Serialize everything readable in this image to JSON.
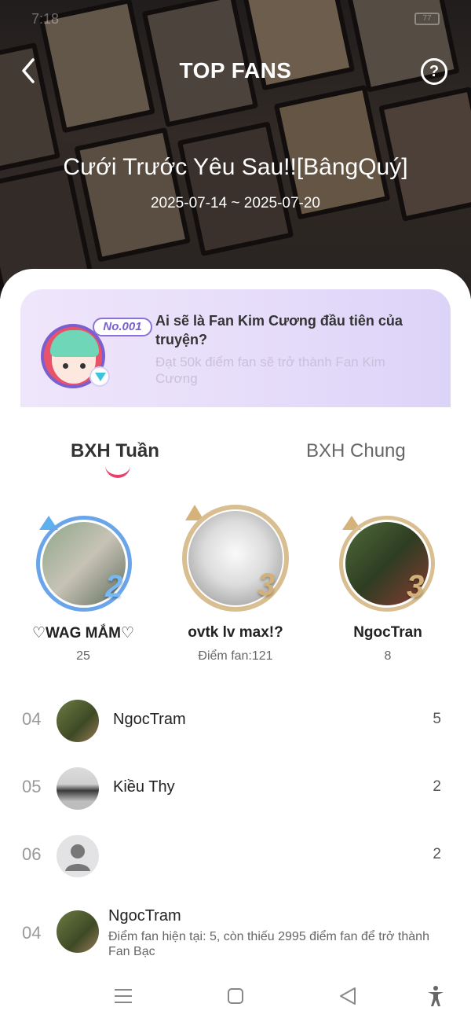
{
  "status": {
    "time": "7:18",
    "battery": "77"
  },
  "header": {
    "title": "TOP FANS",
    "help": "?",
    "story_title": "Cưới Trước Yêu Sau!![BângQuý]",
    "date_range": "2025-07-14 ~ 2025-07-20"
  },
  "banner": {
    "badge": "No.001",
    "title": "Ai sẽ là Fan Kim Cương đầu tiên của truyện?",
    "subtitle": "Đạt 50k điểm fan sẽ trở thành Fan Kim Cương"
  },
  "tabs": {
    "weekly": "BXH Tuần",
    "overall": "BXH Chung"
  },
  "podium": [
    {
      "rank": "2",
      "name": "♡WAG MẮM♡",
      "score": "25"
    },
    {
      "rank": "3",
      "name": "ovtk lv max!?",
      "score": "Điểm fan:121"
    },
    {
      "rank": "3",
      "name": "NgocTran",
      "score": "8"
    }
  ],
  "list": [
    {
      "rank": "04",
      "name": "NgocTram",
      "points": "5"
    },
    {
      "rank": "05",
      "name": "Kiều Thy",
      "points": "2"
    },
    {
      "rank": "06",
      "name": "",
      "points": "2"
    }
  ],
  "my_rank": {
    "rank": "04",
    "name": "NgocTram",
    "status": "Điểm fan hiện tại: 5, còn thiếu 2995 điểm fan để trở thành Fan Bạc"
  },
  "colors": {
    "accent": "#e8406a",
    "banner_purple": "#7b5fd0",
    "silver_ring": "#6aa5ea",
    "gold_ring": "#c9a56a"
  }
}
